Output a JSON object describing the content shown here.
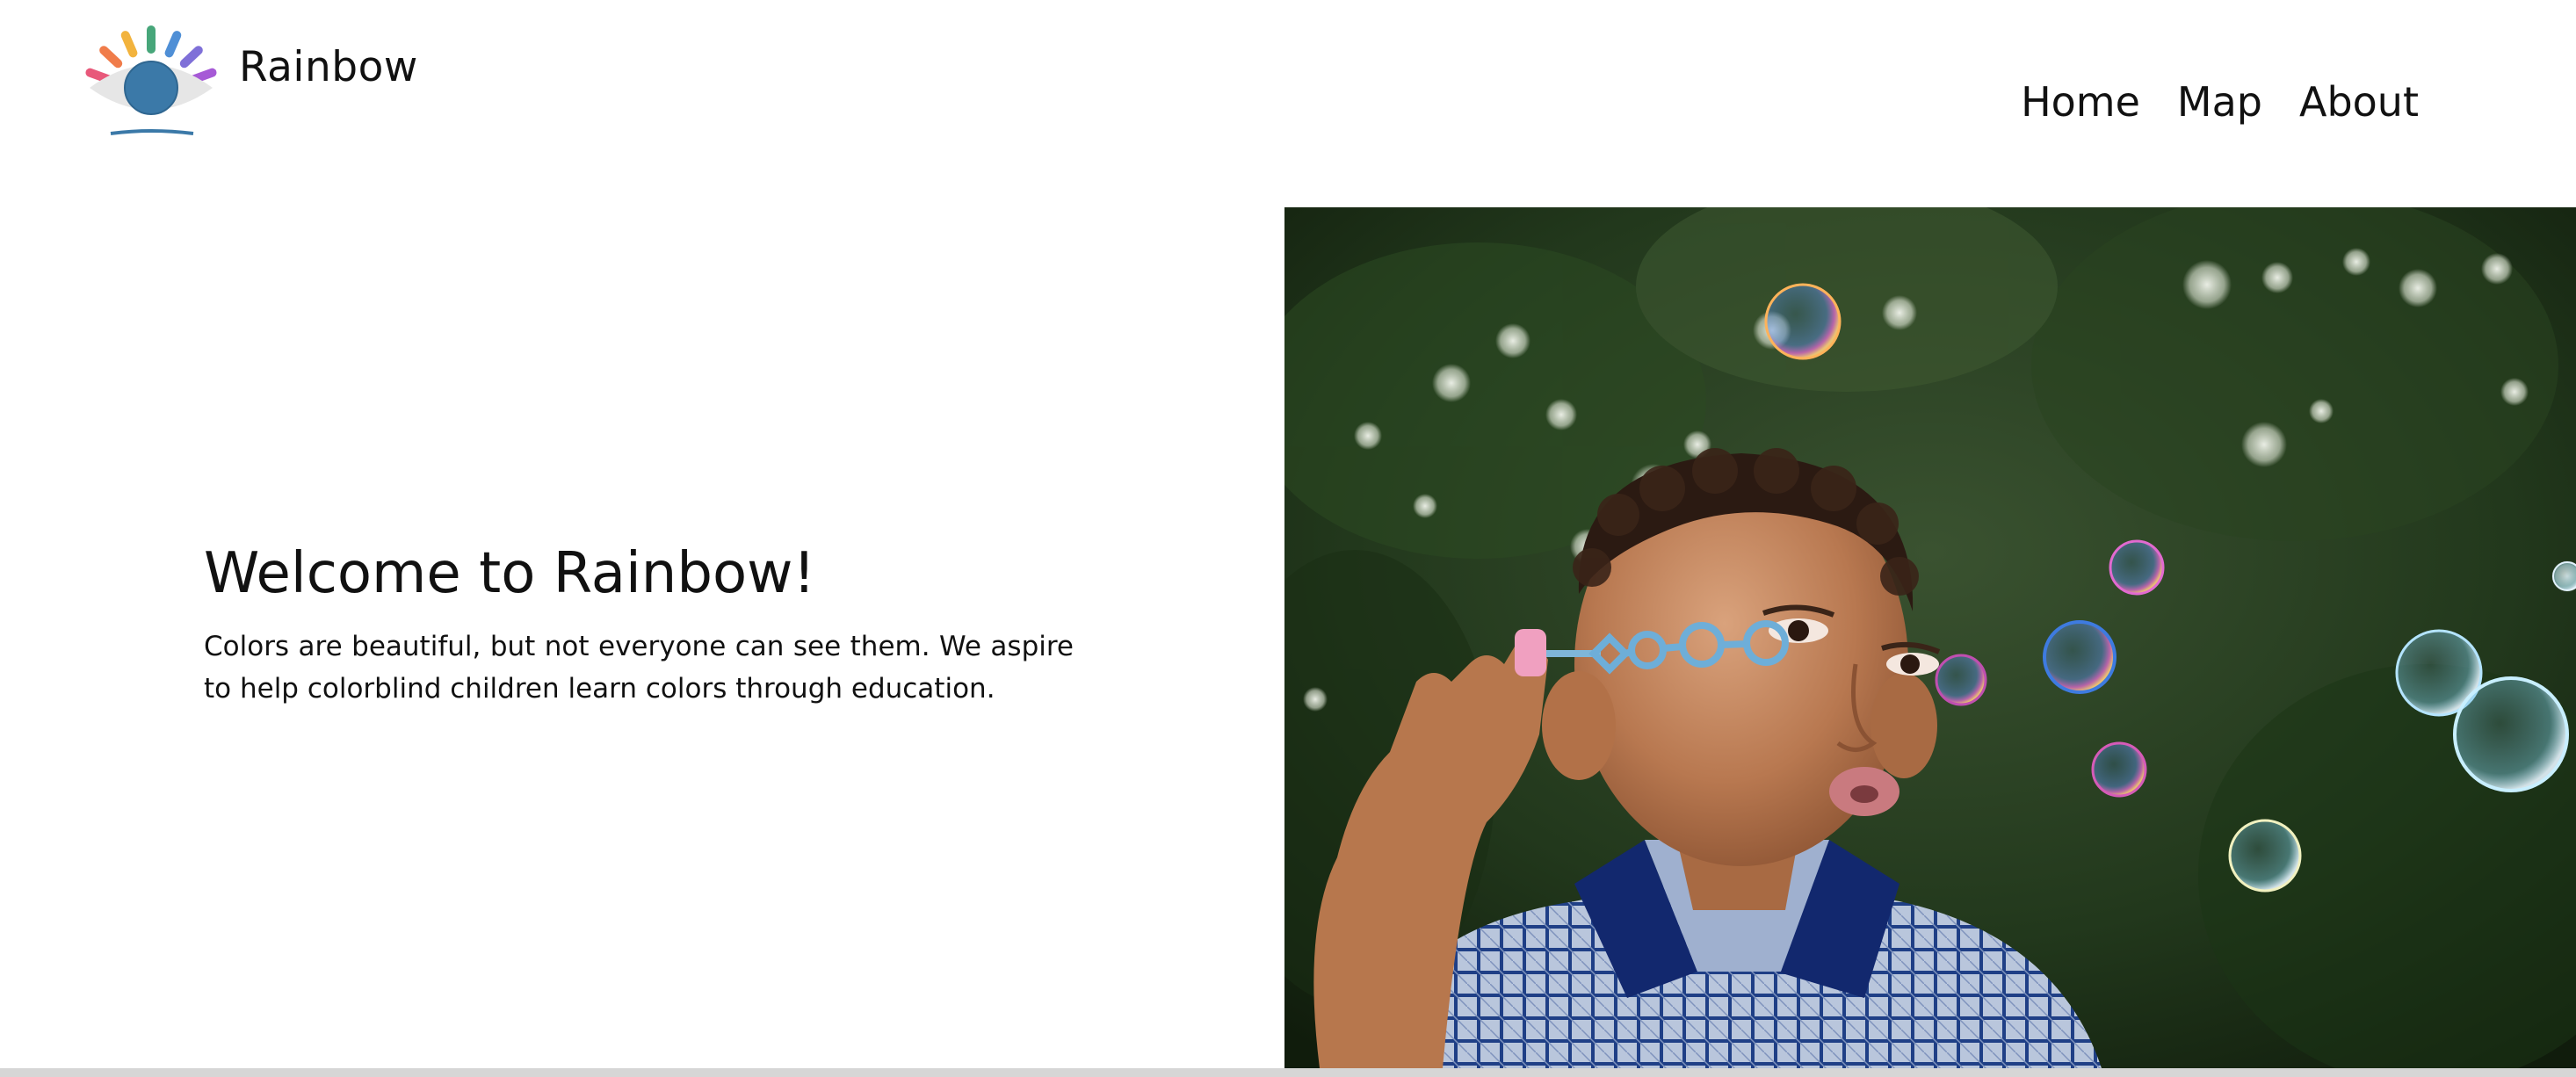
{
  "brand": {
    "name": "Rainbow",
    "logo_icon": "rainbow-eye-logo",
    "ray_colors": [
      "#e8587a",
      "#f07c4a",
      "#f2b33d",
      "#47a67a",
      "#4f8fd6",
      "#7f70d8",
      "#a65ad6"
    ],
    "iris_color": "#3b79a8"
  },
  "nav": {
    "items": [
      {
        "label": "Home"
      },
      {
        "label": "Map"
      },
      {
        "label": "About"
      }
    ]
  },
  "hero": {
    "title": "Welcome to Rainbow!",
    "description": "Colors are beautiful, but not everyone can see them. We aspire to help colorblind children learn colors through education."
  },
  "photo": {
    "subject": "child blowing soap bubbles",
    "background_color": "#1f3318",
    "shirt_color": "#17307a"
  }
}
